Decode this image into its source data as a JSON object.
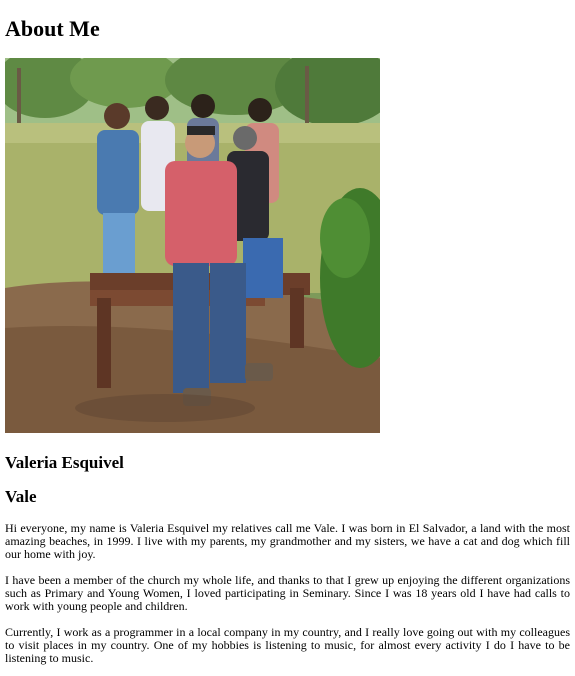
{
  "page": {
    "title": "About Me",
    "photo_alt": "Family photo in a park",
    "name": "Valeria Esquivel",
    "nickname": "Vale",
    "paragraphs": [
      "Hi everyone, my name is Valeria Esquivel my relatives call me Vale. I was born in El Salvador, a land with the most amazing beaches, in 1999. I live with my parents, my grandmother and my sisters, we have a cat and dog which fill our home with joy.",
      "I have been a member of the church my whole life, and thanks to that I grew up enjoying the different organizations such as Primary and Young Women, I loved participating in Seminary. Since I was 18 years old I have had calls to work with young people and children.",
      "Currently, I work as a programmer in a local company in my country, and I really love going out with my colleagues to visit places in my country. One of my hobbies is listening to music, for almost every activity I do I have to be listening to music."
    ]
  }
}
